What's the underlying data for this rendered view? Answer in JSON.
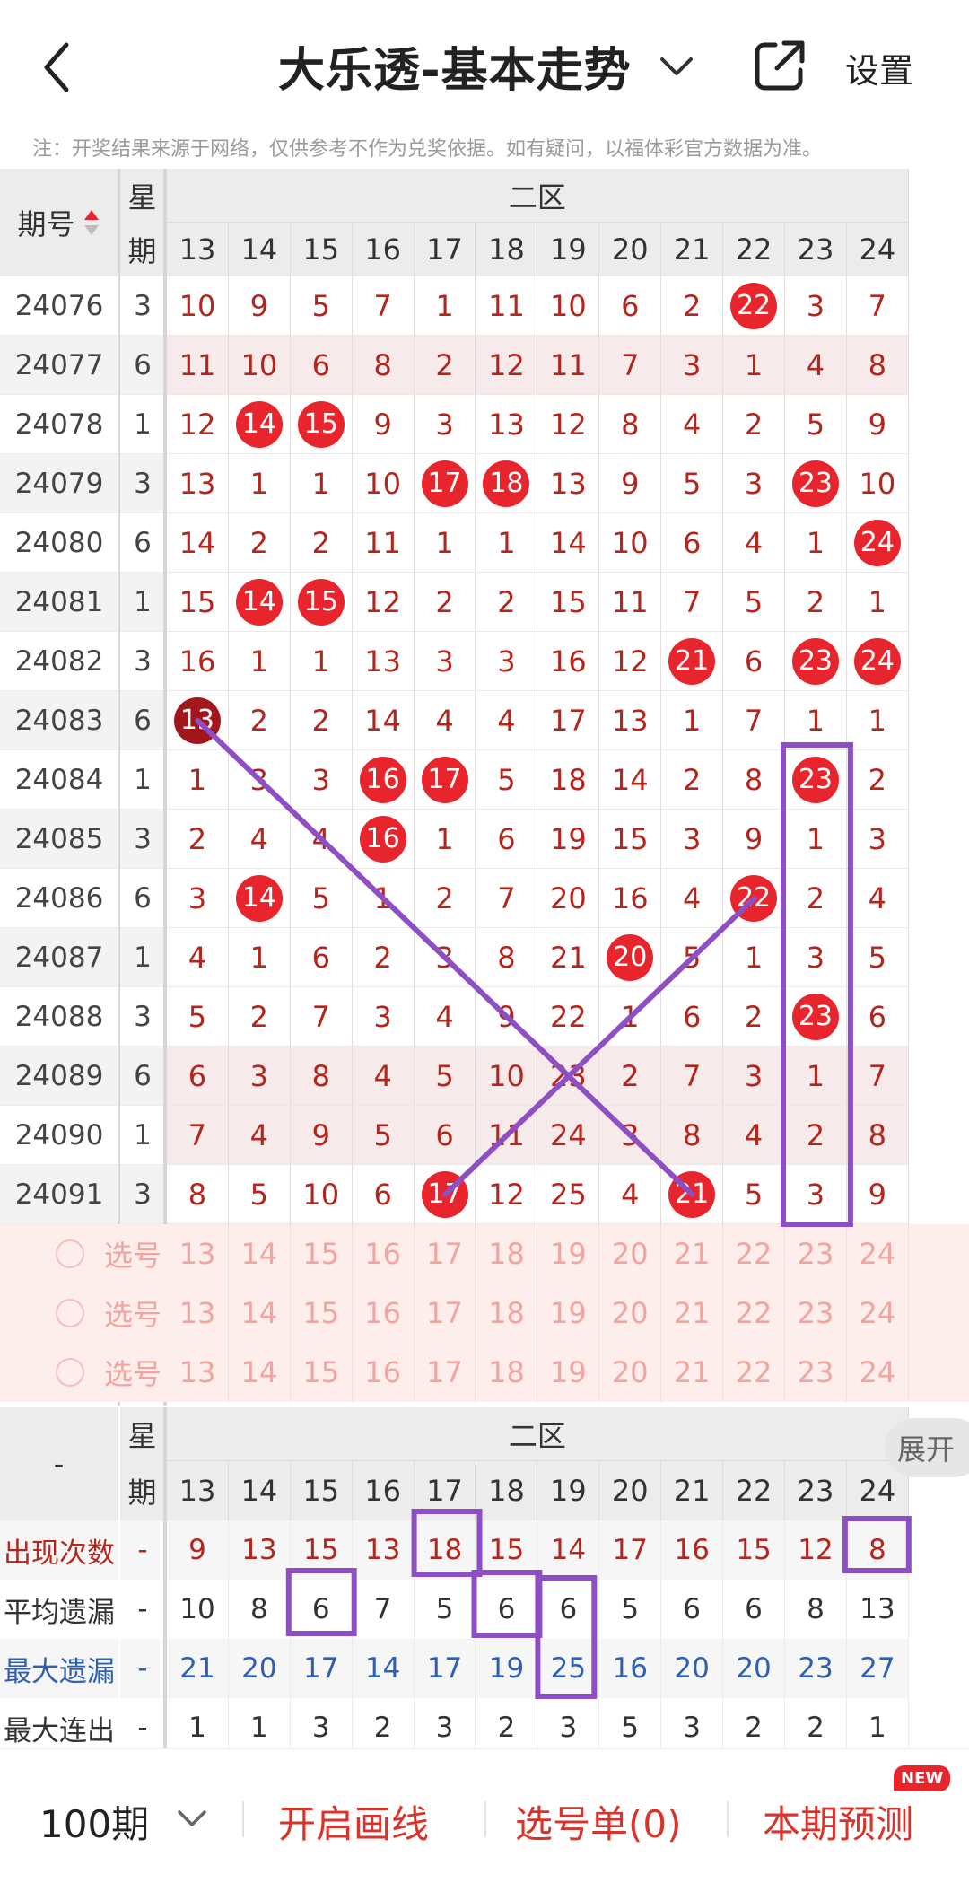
{
  "header": {
    "title": "大乐透-基本走势",
    "settings_label": "设置"
  },
  "notice": "注：开奖结果来源于网络，仅供参考不作为兑奖依据。如有疑问，以福体彩官方数据为准。",
  "table": {
    "issue_header": "期号",
    "week_header_top": "星",
    "week_header_bottom": "期",
    "zone_label": "二区",
    "columns": [
      "13",
      "14",
      "15",
      "16",
      "17",
      "18",
      "19",
      "20",
      "21",
      "22",
      "23",
      "24"
    ],
    "rows": [
      {
        "issue": "24076",
        "week": "3",
        "values": [
          "10",
          "9",
          "5",
          "7",
          "1",
          "11",
          "10",
          "6",
          "2",
          "22",
          "3",
          "7"
        ],
        "hits": [
          9
        ]
      },
      {
        "issue": "24077",
        "week": "6",
        "values": [
          "11",
          "10",
          "6",
          "8",
          "2",
          "12",
          "11",
          "7",
          "3",
          "1",
          "4",
          "8"
        ],
        "hits": []
      },
      {
        "issue": "24078",
        "week": "1",
        "values": [
          "12",
          "14",
          "15",
          "9",
          "3",
          "13",
          "12",
          "8",
          "4",
          "2",
          "5",
          "9"
        ],
        "hits": [
          1,
          2
        ]
      },
      {
        "issue": "24079",
        "week": "3",
        "values": [
          "13",
          "1",
          "1",
          "10",
          "17",
          "18",
          "13",
          "9",
          "5",
          "3",
          "23",
          "10"
        ],
        "hits": [
          4,
          5,
          10
        ]
      },
      {
        "issue": "24080",
        "week": "6",
        "values": [
          "14",
          "2",
          "2",
          "11",
          "1",
          "1",
          "14",
          "10",
          "6",
          "4",
          "1",
          "24"
        ],
        "hits": [
          11
        ]
      },
      {
        "issue": "24081",
        "week": "1",
        "values": [
          "15",
          "14",
          "15",
          "12",
          "2",
          "2",
          "15",
          "11",
          "7",
          "5",
          "2",
          "1"
        ],
        "hits": [
          1,
          2
        ]
      },
      {
        "issue": "24082",
        "week": "3",
        "values": [
          "16",
          "1",
          "1",
          "13",
          "3",
          "3",
          "16",
          "12",
          "21",
          "6",
          "23",
          "24"
        ],
        "hits": [
          8,
          10,
          11
        ]
      },
      {
        "issue": "24083",
        "week": "6",
        "values": [
          "13",
          "2",
          "2",
          "14",
          "4",
          "4",
          "17",
          "13",
          "1",
          "7",
          "1",
          "1"
        ],
        "hits": [
          0
        ]
      },
      {
        "issue": "24084",
        "week": "1",
        "values": [
          "1",
          "3",
          "3",
          "16",
          "17",
          "5",
          "18",
          "14",
          "2",
          "8",
          "23",
          "2"
        ],
        "hits": [
          3,
          4,
          10
        ]
      },
      {
        "issue": "24085",
        "week": "3",
        "values": [
          "2",
          "4",
          "4",
          "16",
          "1",
          "6",
          "19",
          "15",
          "3",
          "9",
          "1",
          "3"
        ],
        "hits": [
          3
        ]
      },
      {
        "issue": "24086",
        "week": "6",
        "values": [
          "3",
          "14",
          "5",
          "1",
          "2",
          "7",
          "20",
          "16",
          "4",
          "22",
          "2",
          "4"
        ],
        "hits": [
          1,
          9
        ]
      },
      {
        "issue": "24087",
        "week": "1",
        "values": [
          "4",
          "1",
          "6",
          "2",
          "3",
          "8",
          "21",
          "20",
          "5",
          "1",
          "3",
          "5"
        ],
        "hits": [
          7
        ]
      },
      {
        "issue": "24088",
        "week": "3",
        "values": [
          "5",
          "2",
          "7",
          "3",
          "4",
          "9",
          "22",
          "1",
          "6",
          "2",
          "23",
          "6"
        ],
        "hits": [
          10
        ]
      },
      {
        "issue": "24089",
        "week": "6",
        "values": [
          "6",
          "3",
          "8",
          "4",
          "5",
          "10",
          "23",
          "2",
          "7",
          "3",
          "1",
          "7"
        ],
        "hits": []
      },
      {
        "issue": "24090",
        "week": "1",
        "values": [
          "7",
          "4",
          "9",
          "5",
          "6",
          "11",
          "24",
          "3",
          "8",
          "4",
          "2",
          "8"
        ],
        "hits": []
      },
      {
        "issue": "24091",
        "week": "3",
        "values": [
          "8",
          "5",
          "10",
          "6",
          "17",
          "12",
          "25",
          "4",
          "21",
          "5",
          "3",
          "9"
        ],
        "hits": [
          4,
          8
        ]
      }
    ],
    "select_label": "选号",
    "select_rows": 3
  },
  "stats": {
    "corner": "-",
    "week_header_top": "星",
    "week_header_bottom": "期",
    "zone_label": "二区",
    "expand_label": "展开",
    "rows": [
      {
        "label": "出现次数",
        "week": "-",
        "style": "red",
        "values": [
          "9",
          "13",
          "15",
          "13",
          "18",
          "15",
          "14",
          "17",
          "16",
          "15",
          "12",
          "8"
        ]
      },
      {
        "label": "平均遗漏",
        "week": "-",
        "style": "dark",
        "values": [
          "10",
          "8",
          "6",
          "7",
          "5",
          "6",
          "6",
          "5",
          "6",
          "6",
          "8",
          "13"
        ]
      },
      {
        "label": "最大遗漏",
        "week": "-",
        "style": "blue",
        "values": [
          "21",
          "20",
          "17",
          "14",
          "17",
          "19",
          "25",
          "16",
          "20",
          "20",
          "23",
          "27"
        ]
      },
      {
        "label": "最大连出",
        "week": "-",
        "style": "dark",
        "values": [
          "1",
          "1",
          "3",
          "2",
          "3",
          "2",
          "3",
          "5",
          "3",
          "2",
          "2",
          "1"
        ]
      }
    ]
  },
  "bottom_bar": {
    "period": "100期",
    "draw_line": "开启画线",
    "selection_list": "选号单(0)",
    "prediction": "本期预测",
    "new_badge": "NEW"
  },
  "colors": {
    "accent_red": "#e8252c",
    "text_red": "#b3261e",
    "text_blue": "#2f5fb3",
    "annotation_purple": "#8e4fc4"
  }
}
